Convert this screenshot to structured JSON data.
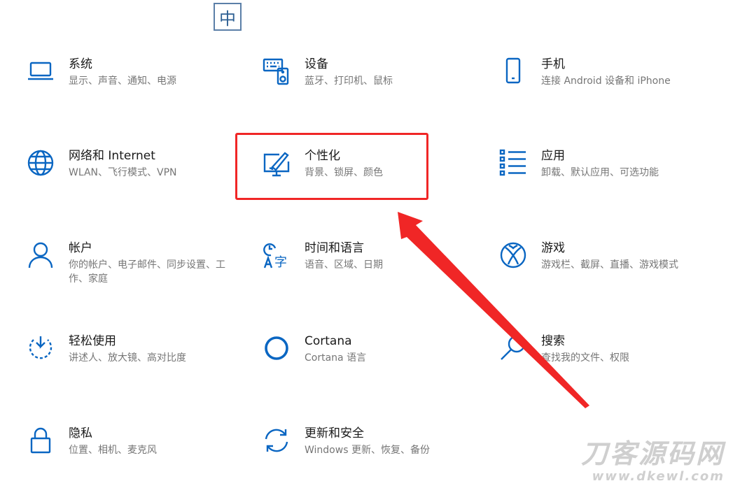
{
  "ime": {
    "label": "中"
  },
  "tiles": [
    {
      "title": "系统",
      "desc": "显示、声音、通知、电源",
      "icon": "laptop-icon"
    },
    {
      "title": "设备",
      "desc": "蓝牙、打印机、鼠标",
      "icon": "keyboard-speaker-icon"
    },
    {
      "title": "手机",
      "desc": "连接 Android 设备和 iPhone",
      "icon": "phone-icon"
    },
    {
      "title": "网络和 Internet",
      "desc": "WLAN、飞行模式、VPN",
      "icon": "globe-icon"
    },
    {
      "title": "个性化",
      "desc": "背景、锁屏、颜色",
      "icon": "paint-brush-icon"
    },
    {
      "title": "应用",
      "desc": "卸载、默认应用、可选功能",
      "icon": "app-list-icon"
    },
    {
      "title": "帐户",
      "desc": "你的帐户、电子邮件、同步设置、工作、家庭",
      "icon": "person-icon"
    },
    {
      "title": "时间和语言",
      "desc": "语音、区域、日期",
      "icon": "time-language-icon"
    },
    {
      "title": "游戏",
      "desc": "游戏栏、截屏、直播、游戏模式",
      "icon": "xbox-icon"
    },
    {
      "title": "轻松使用",
      "desc": "讲述人、放大镜、高对比度",
      "icon": "ease-of-access-icon"
    },
    {
      "title": "Cortana",
      "desc": "Cortana 语言",
      "icon": "cortana-icon"
    },
    {
      "title": "搜索",
      "desc": "查找我的文件、权限",
      "icon": "search-icon"
    },
    {
      "title": "隐私",
      "desc": "位置、相机、麦克风",
      "icon": "lock-icon"
    },
    {
      "title": "更新和安全",
      "desc": "Windows 更新、恢复、备份",
      "icon": "sync-icon"
    }
  ],
  "annotation": {
    "highlight_color": "#f02626",
    "accent_color": "#0a66c2"
  },
  "watermark": {
    "title": "刀客源码网",
    "url": "www.dkewl.com"
  }
}
